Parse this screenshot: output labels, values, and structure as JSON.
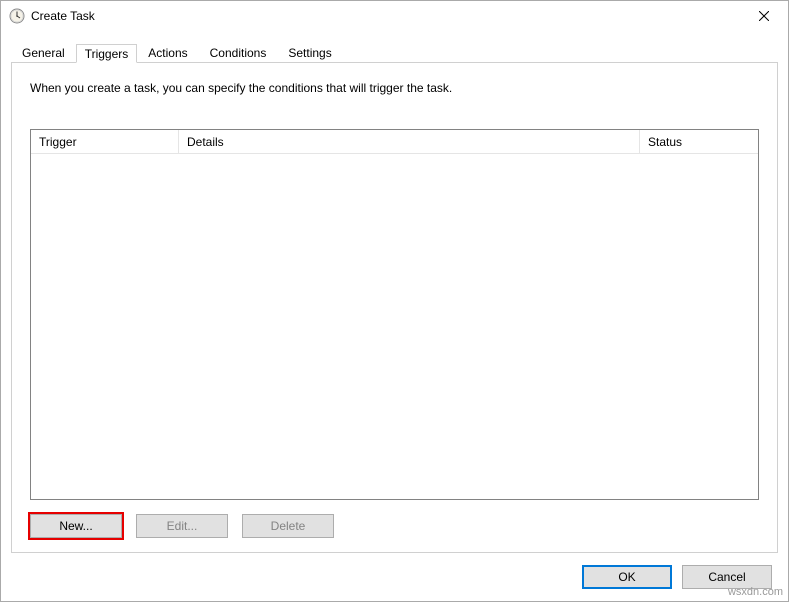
{
  "window": {
    "title": "Create Task"
  },
  "tabs": {
    "general": "General",
    "triggers": "Triggers",
    "actions": "Actions",
    "conditions": "Conditions",
    "settings": "Settings"
  },
  "panel": {
    "description": "When you create a task, you can specify the conditions that will trigger the task."
  },
  "columns": {
    "trigger": "Trigger",
    "details": "Details",
    "status": "Status"
  },
  "buttons": {
    "new": "New...",
    "edit": "Edit...",
    "delete": "Delete",
    "ok": "OK",
    "cancel": "Cancel"
  },
  "watermark": "wsxdn.com"
}
